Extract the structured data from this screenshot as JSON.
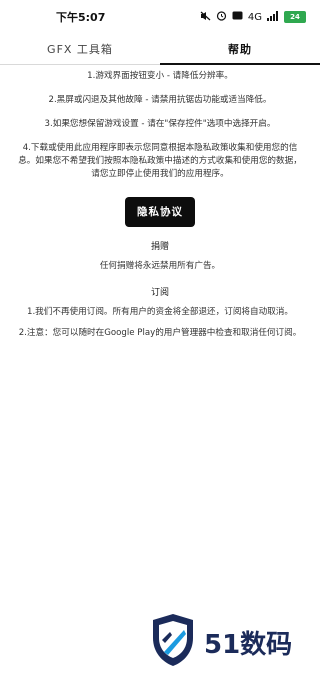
{
  "status_bar": {
    "time": "下午5:07",
    "network": "4G",
    "battery": "24"
  },
  "tabs": [
    {
      "label": "GFX 工具箱",
      "active": false
    },
    {
      "label": "帮助",
      "active": true
    }
  ],
  "help": {
    "tip1": "1.游戏界面按钮变小 - 请降低分辨率。",
    "tip2": "2.黑屏或闪退及其他故障 - 请禁用抗锯齿功能或适当降低。",
    "tip3": "3.如果您想保留游戏设置 - 请在\"保存控件\"选项中选择开启。",
    "tip4": "4.下载或使用此应用程序即表示您同意根据本隐私政策收集和使用您的信息。如果您不希望我们按照本隐私政策中描述的方式收集和使用您的数据，请您立即停止使用我们的应用程序。",
    "privacy_button": "隐私协议"
  },
  "donation": {
    "title": "捐赠",
    "text": "任何捐赠将永远禁用所有广告。"
  },
  "subscription": {
    "title": "订阅",
    "item1": "1.我们不再使用订阅。所有用户的资金将全部退还，订阅将自动取消。",
    "item2": "2.注意：您可以随时在Google Play的用户管理器中检查和取消任何订阅。"
  },
  "watermark": {
    "text": "51数码"
  },
  "colors": {
    "accent": "#0d0d0d",
    "battery": "#2fa84f",
    "watermark": "#1b2b5a"
  }
}
